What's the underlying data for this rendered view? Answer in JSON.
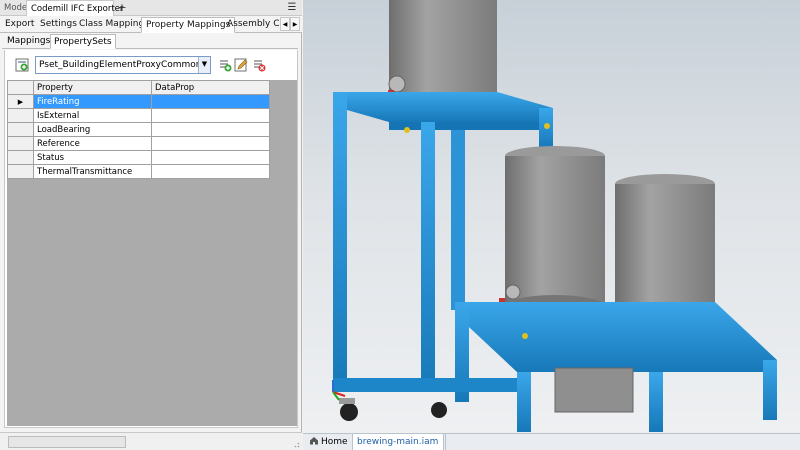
{
  "window": {
    "model_tab": "Model",
    "exporter_tab": "Codemill IFC Exporter",
    "add_tab": "+",
    "menu_glyph": "☰"
  },
  "main_tabs": [
    {
      "label": "Export"
    },
    {
      "label": "Settings"
    },
    {
      "label": "Class Mappings"
    },
    {
      "label": "Property Mappings",
      "active": true
    },
    {
      "label": "Assembly Co"
    }
  ],
  "tab_scroll": {
    "left": "◀",
    "right": "▶"
  },
  "sub_tabs": [
    {
      "label": "Mappings"
    },
    {
      "label": "PropertySets",
      "active": true
    }
  ],
  "toolbar": {
    "propset_value": "Pset_BuildingElementProxyCommon",
    "dropdown_glyph": "▼",
    "icons": [
      "add-propset-icon",
      "add-property-icon",
      "edit-property-icon",
      "remove-property-icon"
    ]
  },
  "grid": {
    "columns": [
      "Property",
      "DataProp"
    ],
    "current_row_marker": "▶",
    "rows": [
      {
        "property": "FireRating",
        "dataprop": "",
        "selected": true
      },
      {
        "property": "IsExternal",
        "dataprop": ""
      },
      {
        "property": "LoadBearing",
        "dataprop": ""
      },
      {
        "property": "Reference",
        "dataprop": ""
      },
      {
        "property": "Status",
        "dataprop": ""
      },
      {
        "property": "ThermalTransmittance",
        "dataprop": ""
      }
    ]
  },
  "documents": {
    "home_label": "Home",
    "file_label": "brewing-main.iam"
  },
  "colors": {
    "selection": "#3399ff",
    "frame_blue": "#1e8fd6",
    "tank_gray": "#8e8e8e"
  }
}
